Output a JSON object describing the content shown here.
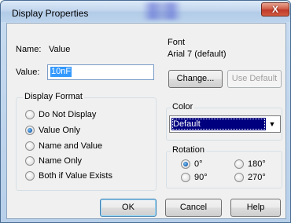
{
  "window": {
    "title": "Display Properties",
    "close_label": "X"
  },
  "name_row": {
    "label": "Name:",
    "value": "Value"
  },
  "value_row": {
    "label": "Value:",
    "value": "10nF"
  },
  "display_format": {
    "caption": "Display Format",
    "options": [
      {
        "label": "Do Not Display",
        "checked": false
      },
      {
        "label": "Value Only",
        "checked": true
      },
      {
        "label": "Name and Value",
        "checked": false
      },
      {
        "label": "Name Only",
        "checked": false
      },
      {
        "label": "Both if Value Exists",
        "checked": false
      }
    ]
  },
  "font": {
    "caption": "Font",
    "current": "Arial 7 (default)",
    "change_label": "Change...",
    "use_default_label": "Use Default"
  },
  "color": {
    "caption": "Color",
    "selected": "Default",
    "selected_bg": "#00007f"
  },
  "rotation": {
    "caption": "Rotation",
    "options": [
      {
        "label": "0°",
        "checked": true
      },
      {
        "label": "180°",
        "checked": false
      },
      {
        "label": "90°",
        "checked": false
      },
      {
        "label": "270°",
        "checked": false
      }
    ]
  },
  "buttons": {
    "ok": "OK",
    "cancel": "Cancel",
    "help": "Help"
  }
}
